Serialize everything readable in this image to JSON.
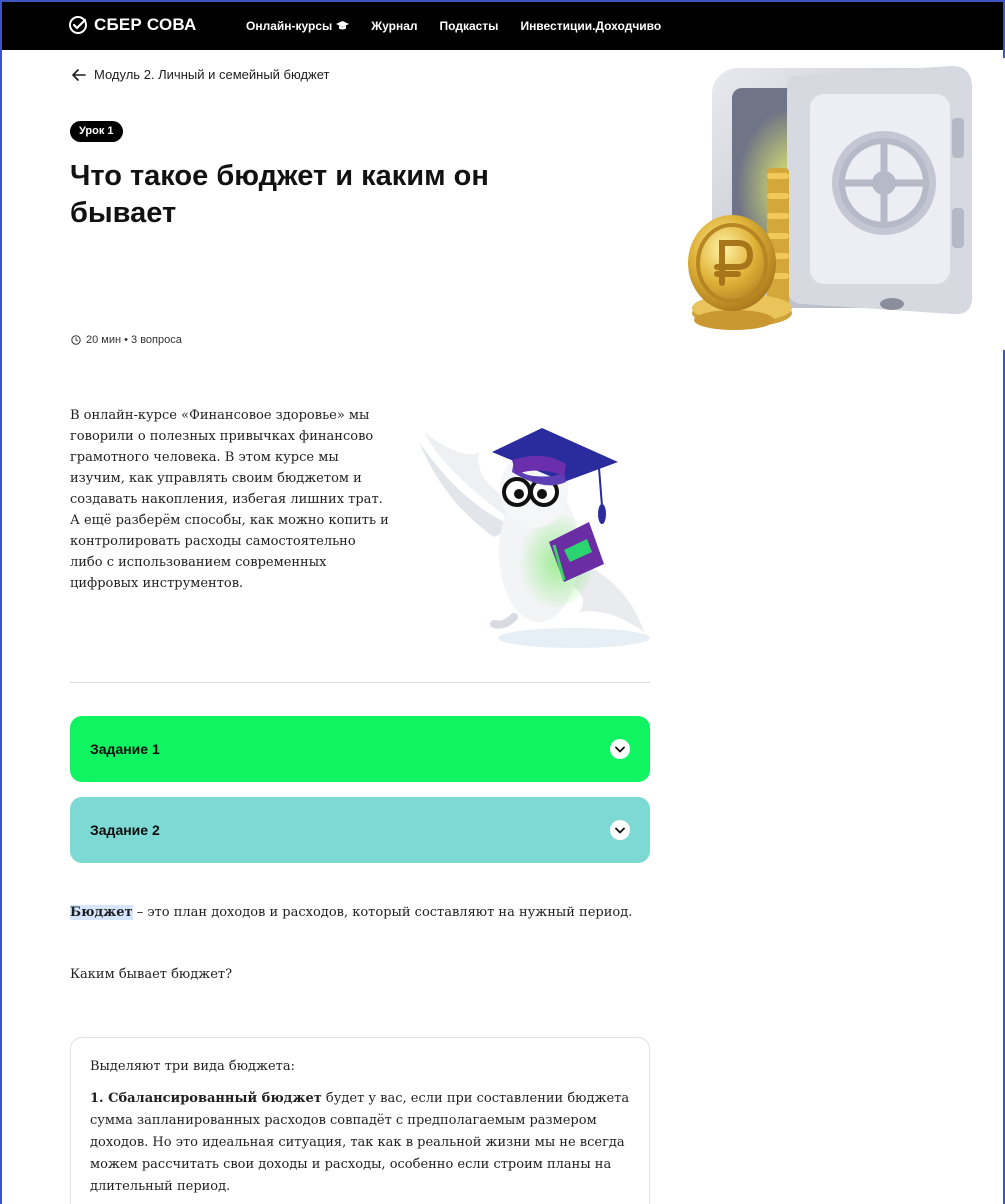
{
  "nav": {
    "logo_text": "СБЕР СОВА",
    "links": [
      "Онлайн-курсы",
      "Журнал",
      "Подкасты",
      "Инвестиции.Доходчиво"
    ]
  },
  "hero": {
    "back_label": "Модуль 2. Личный и семейный бюджет",
    "badge": "Урок 1",
    "title": "Что такое бюджет и каким он бывает",
    "meta": "20 мин • 3 вопроса"
  },
  "intro": {
    "text": "В онлайн-курсе «Финансовое здоровье» мы говорили о полезных привычках финансово грамотного человека. В этом курсе мы изучим, как управлять своим бюджетом и создавать накопления, избегая лишних трат. А ещё разберём способы, как можно копить и контролировать расходы самостоятельно либо с использованием современных цифровых инструментов."
  },
  "tasks": [
    {
      "label": "Задание 1",
      "color": "#10f461"
    },
    {
      "label": "Задание 2",
      "color": "#7cd9d3"
    }
  ],
  "definition": {
    "term": "Бюджет",
    "rest": " – это план доходов и расходов, который составляют на нужный период."
  },
  "question": "Каким бывает бюджет?",
  "card": {
    "intro": "Выделяют три вида бюджета:",
    "item1_bold": "1. Сбалансированный бюджет",
    "item1_text": " будет у вас, если при составлении бюджета сумма запланированных расходов совпадёт с предполагаемым размером доходов. Но это идеальная ситуация, так как в реальной жизни мы не всегда можем рассчитать свои доходы и расходы, особенно если строим планы на длительный период."
  },
  "colors": {
    "nav_bg": "#000000",
    "task1": "#10f461",
    "task2": "#7cd9d3",
    "frame": "#3b56c4"
  }
}
